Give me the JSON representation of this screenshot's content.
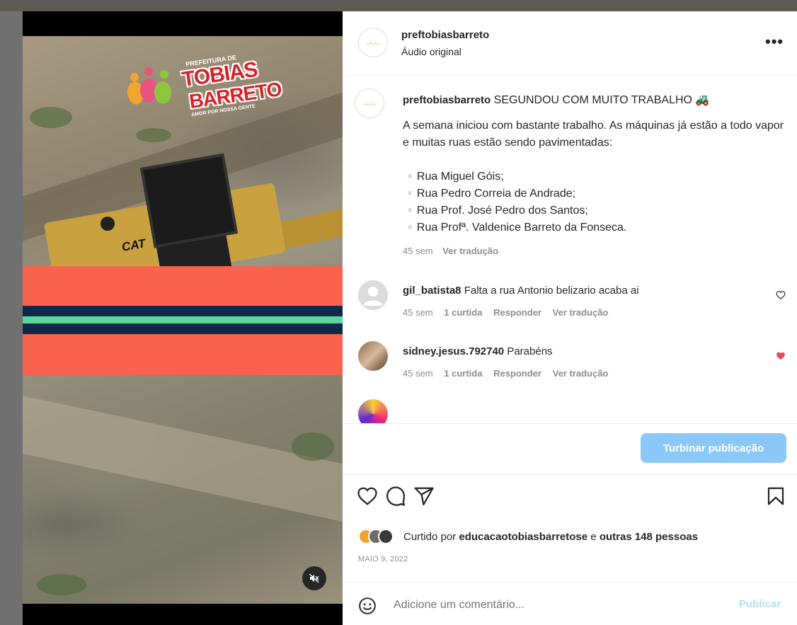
{
  "post": {
    "username": "preftobiasbarreto",
    "audio": "Áudio original",
    "more": "•••",
    "logo_text_top": "PREFEITURA DE",
    "logo_text_1": "TOBIAS",
    "logo_text_2": "BARRETO",
    "logo_text_bottom": "AMOR POR NOSSA GENTE",
    "vehicle_text": "CAT"
  },
  "caption": {
    "username": "preftobiasbarreto",
    "headline": "SEGUNDOU COM MUITO TRABALHO 🚜",
    "body": "A semana iniciou com bastante trabalho. As máquinas já estão a todo vapor e muitas ruas estão sendo pavimentadas:",
    "streets": [
      "▫️Rua Miguel Góis;",
      "▫️Rua Pedro Correia de Andrade;",
      "▫️Rua Prof. José Pedro dos Santos;",
      "▫️Rua Profª. Valdenice Barreto da Fonseca."
    ],
    "time": "45 sem",
    "translate": "Ver tradução"
  },
  "comments": [
    {
      "username": "gil_batista8",
      "text": "Falta a rua Antonio belizario acaba ai",
      "time": "45 sem",
      "likes": "1 curtida",
      "reply": "Responder",
      "translate": "Ver tradução",
      "liked": false
    },
    {
      "username": "sidney.jesus.792740",
      "text": "Parabéns",
      "time": "45 sem",
      "likes": "1 curtida",
      "reply": "Responder",
      "translate": "Ver tradução",
      "liked": true
    }
  ],
  "boost_label": "Turbinar publicação",
  "liked_by": {
    "prefix": "Curtido por",
    "user": "educacaotobiasbarretose",
    "joiner": "e",
    "others": "outras 148 pessoas"
  },
  "date": "MAIO 9, 2022",
  "add_comment": {
    "placeholder": "Adicione um comentário...",
    "publish": "Publicar"
  },
  "colors": {
    "banner_coral": "#f9634e",
    "banner_navy": "#0e2a48",
    "banner_green": "#5cd59b",
    "boost_blue": "#89c8f8",
    "heart_red": "#ed4956"
  },
  "icons": [
    "heart-icon",
    "comment-icon",
    "share-icon",
    "bookmark-icon",
    "emoji-icon",
    "mute-icon",
    "more-icon"
  ]
}
